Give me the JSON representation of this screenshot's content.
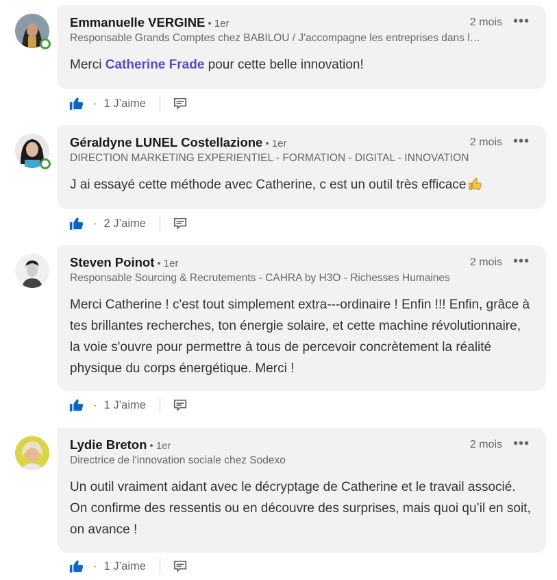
{
  "comments": [
    {
      "name": "Emmanuelle VERGINE",
      "degree": "• 1er",
      "headline": "Responsable Grands Comptes chez BABILOU / J'accompagne les entreprises dans leur politique petite enfance",
      "time": "2 mois",
      "more": "•••",
      "text_before": "Merci ",
      "mention": "Catherine Frade",
      "text_after": " pour cette belle innovation!",
      "likes": "1 J’aime",
      "online": true
    },
    {
      "name": "Géraldyne LUNEL Costellazione",
      "degree": "• 1er",
      "headline": "DIRECTION MARKETING EXPERIENTIEL - FORMATION - DIGITAL - INNOVATION",
      "time": "2 mois",
      "more": "•••",
      "text": "J ai essayé cette méthode avec Catherine, c est un outil très efficace",
      "likes": "2 J’aime",
      "online": true
    },
    {
      "name": "Steven Poinot",
      "degree": "• 1er",
      "headline": "Responsable Sourcing & Recrutements - CAHRA by H3O - Richesses Humaines",
      "time": "2 mois",
      "more": "•••",
      "text": "Merci Catherine ! c'est tout simplement extra---ordinaire ! Enfin !!! Enfin, grâce à tes brillantes recherches, ton énergie solaire, et cette machine révolutionnaire, la voie s'ouvre pour permettre à tous de percevoir concrètement la réalité physique du corps énergétique. Merci !",
      "likes": "1 J’aime",
      "online": false
    },
    {
      "name": "Lydie Breton",
      "degree": "• 1er",
      "headline": "Directrice de l'innovation sociale chez Sodexo",
      "time": "2 mois",
      "more": "•••",
      "text": "Un outil vraiment aidant avec le décryptage de Catherine et le travail associé. On confirme des ressentis ou en découvre des surprises, mais quoi qu’il en soit, on avance !",
      "likes": "1 J’aime",
      "online": false
    }
  ],
  "separator_dot": "·",
  "colors": {
    "like_blue": "#0a66c2",
    "mention": "#5a48c9",
    "online_green": "#4b9b3c",
    "bubble": "#f2f2f2"
  }
}
